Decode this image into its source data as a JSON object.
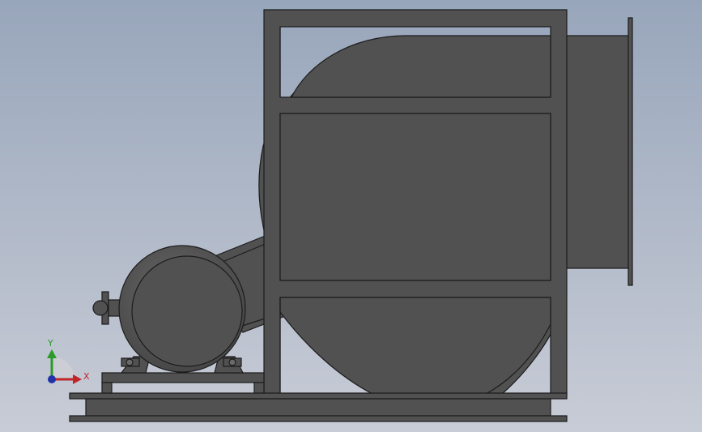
{
  "viewport": {
    "background_top": "#98a6bb",
    "background_bottom": "#c8ccd6"
  },
  "model": {
    "fill": "#515151",
    "stroke": "#1c1c1c",
    "highlight": "#6a6a6a"
  },
  "triad": {
    "x_label": "X",
    "y_label": "Y",
    "x_color": "#c0252a",
    "y_color": "#2a9a2a",
    "z_color": "#2233aa"
  }
}
